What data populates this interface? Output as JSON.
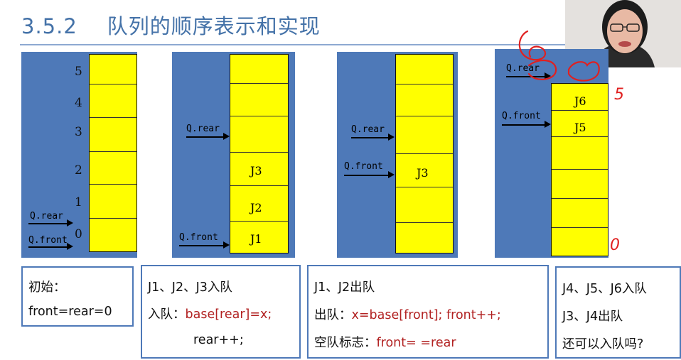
{
  "title": {
    "number": "3.5.2",
    "text": "队列的顺序表示和实现"
  },
  "indices": [
    "5",
    "4",
    "3",
    "2",
    "1",
    "0"
  ],
  "pointers": {
    "rear": "Q.rear",
    "front": "Q.front"
  },
  "diagram_labels": {
    "d2": [
      "J3",
      "J2",
      "J1"
    ],
    "d3": [
      "J3"
    ],
    "d4": [
      "J6",
      "J5"
    ]
  },
  "boxes": {
    "b1": {
      "line1": "初始：",
      "line2": "front=rear=0"
    },
    "b2": {
      "line1": "J1、J2、J3入队",
      "line2_prefix": "入队：",
      "line2_code": "base[rear]=x;",
      "line3_code": "rear++;"
    },
    "b3": {
      "line1": "J1、J2出队",
      "line2_prefix": "出队：",
      "line2_code": "x=base[front]; front++;",
      "line3_prefix": "空队标志：",
      "line3_code": "front= =rear"
    },
    "b4": {
      "line1": "J4、J5、J6入队",
      "line2": "J3、J4出队",
      "line3": "还可以入队吗?"
    }
  },
  "annotations": {
    "top_digit": "6",
    "side_digit": "5",
    "bottom_digit": "0"
  },
  "colors": {
    "title": "#4472a8",
    "panel": "#4e79b8",
    "queue": "#ffff00",
    "code_red": "#b22222",
    "ink_red": "#e02020"
  }
}
